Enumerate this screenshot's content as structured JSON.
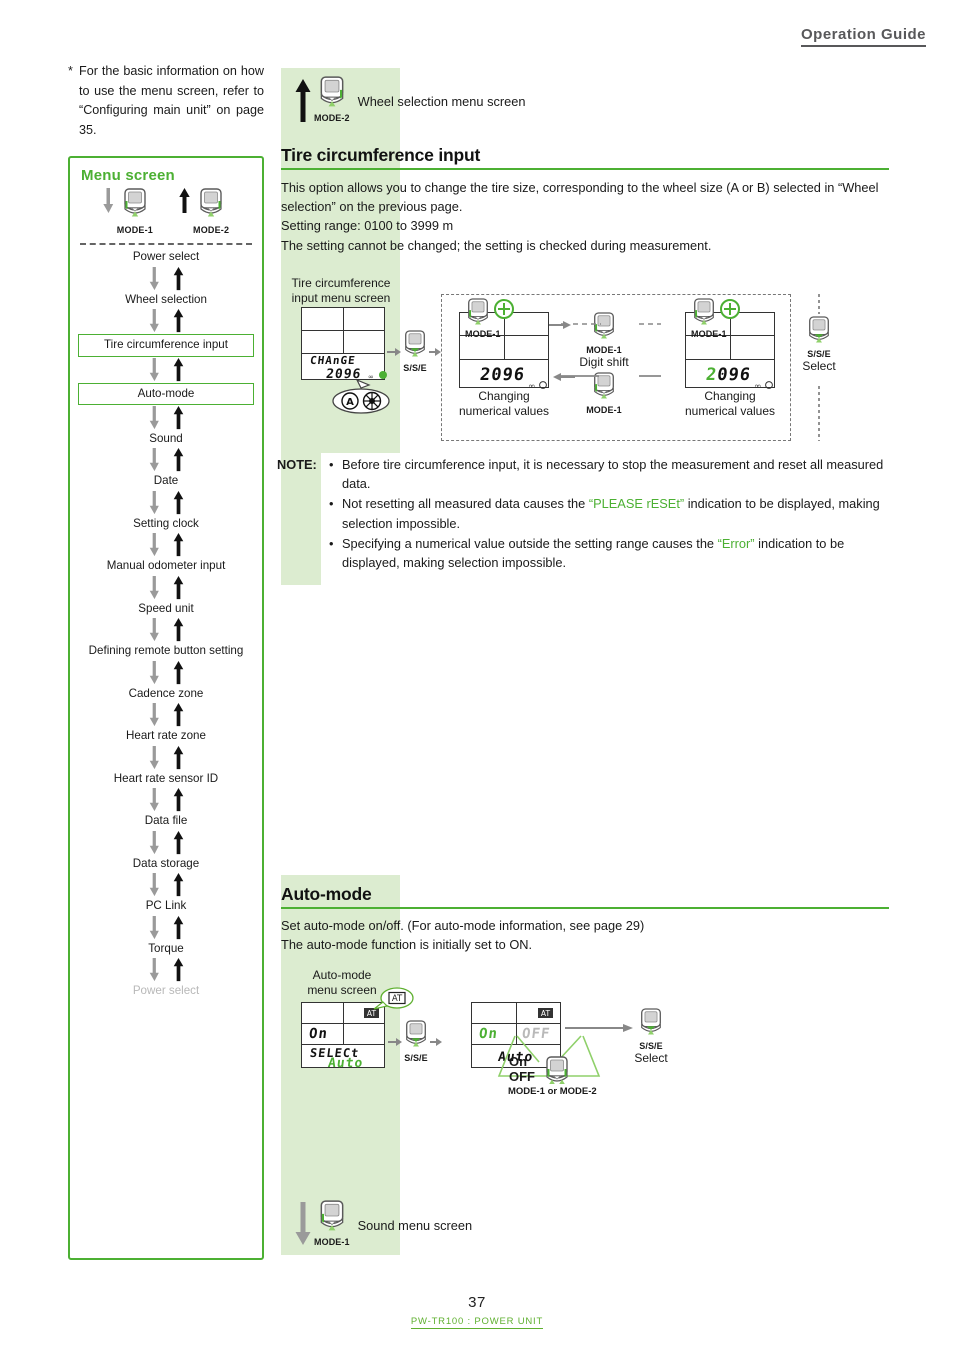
{
  "header": {
    "title": "Operation Guide"
  },
  "footer": {
    "page_number": "37",
    "product_line": "PW-TR100 : POWER UNIT"
  },
  "left": {
    "footnote": "For the basic information on how to use the menu screen, refer to “Configuring main unit” on page 35.",
    "footnote_marker": "*",
    "menu_box": {
      "title": "Menu screen",
      "mode_down_label": "MODE-1",
      "mode_up_label": "MODE-2",
      "items": [
        {
          "label": "Power select",
          "boxed": false,
          "dim": false
        },
        {
          "label": "Wheel selection",
          "boxed": false,
          "dim": false
        },
        {
          "label": "Tire circumference input",
          "boxed": true,
          "dim": false
        },
        {
          "label": "Auto-mode",
          "boxed": true,
          "dim": false
        },
        {
          "label": "Sound",
          "boxed": false,
          "dim": false
        },
        {
          "label": "Date",
          "boxed": false,
          "dim": false
        },
        {
          "label": "Setting clock",
          "boxed": false,
          "dim": false
        },
        {
          "label": "Manual odometer input",
          "boxed": false,
          "dim": false
        },
        {
          "label": "Speed unit",
          "boxed": false,
          "dim": false
        },
        {
          "label": "Defining remote button setting",
          "boxed": false,
          "dim": false
        },
        {
          "label": "Cadence zone",
          "boxed": false,
          "dim": false
        },
        {
          "label": "Heart rate zone",
          "boxed": false,
          "dim": false
        },
        {
          "label": "Heart rate sensor ID",
          "boxed": false,
          "dim": false
        },
        {
          "label": "Data file",
          "boxed": false,
          "dim": false
        },
        {
          "label": "Data storage",
          "boxed": false,
          "dim": false
        },
        {
          "label": "PC Link",
          "boxed": false,
          "dim": false
        },
        {
          "label": "Torque",
          "boxed": false,
          "dim": false
        },
        {
          "label": "Power select",
          "boxed": false,
          "dim": true
        }
      ]
    }
  },
  "top_nav": {
    "mode_label": "MODE-2",
    "caption": "Wheel selection menu screen"
  },
  "tire": {
    "heading": "Tire circumference input",
    "para1": "This option allows you to change the tire size, corresponding to the wheel size (A or B) selected in “Wheel selection” on the previous page.",
    "para2": "Setting range: 0100 to 3999 m",
    "para3": "The setting cannot be changed; the setting is checked during measurement.",
    "diagram": {
      "menu_caption_line1": "Tire circumference",
      "menu_caption_line2": "input menu screen",
      "lcd1_text_top": "CHAnGE",
      "lcd1_text_bottom": "2096",
      "lcd1_badge_a": "A",
      "lcd1_badge_wheel": "wheel-icon",
      "btn_sse": "S/S/E",
      "lcd2_mode_label": "MODE-1",
      "lcd2_value": "2096",
      "lcd2_cap1": "Changing",
      "lcd2_cap2": "numerical values",
      "mid_mode_label": "MODE-1",
      "mid_mode_sub": "Digit shift",
      "mid_mode_label2": "MODE-1",
      "lcd3_mode_label": "MODE-1",
      "lcd3_value": "2096",
      "lcd3_cap1": "Changing",
      "lcd3_cap2": "numerical values",
      "right_btn": "S/S/E",
      "right_btn_sub": "Select",
      "plus_icon": "plus-icon"
    },
    "note": {
      "label": "NOTE:",
      "items": [
        {
          "pre": "Before tire circumference input, it is necessary to stop the measurement and reset all measured data.",
          "green": "",
          "post": ""
        },
        {
          "pre": "Not resetting all measured data causes the ",
          "green": "“PLEASE rESEt”",
          "post": " indication to be displayed, making selection impossible."
        },
        {
          "pre": "Specifying a numerical value outside the setting range causes the ",
          "green": "“Error”",
          "post": " indication to be displayed, making selection impossible."
        }
      ]
    }
  },
  "auto": {
    "heading": "Auto-mode",
    "para1": "Set auto-mode on/off. (For auto-mode information, see page 29)",
    "para2": "The auto-mode function is initially set to ON.",
    "diagram": {
      "menu_caption_line1": "Auto-mode",
      "menu_caption_line2": "menu screen",
      "lcd1_at": "AT",
      "lcd1_on": "On",
      "lcd1_select": "SELECt",
      "lcd1_auto": "Auto",
      "callout_at": "AT",
      "btn_sse": "S/S/E",
      "lcd2_at": "AT",
      "lcd2_on": "On",
      "lcd2_off": "OFF",
      "lcd2_auto": "Auto",
      "choice_on": "On",
      "choice_off": "OFF",
      "choice_btn": "MODE-1 or MODE-2",
      "right_btn": "S/S/E",
      "right_btn_sub": "Select"
    },
    "bottom_nav": {
      "mode_label": "MODE-1",
      "caption": "Sound menu screen"
    }
  },
  "colors": {
    "brand_green": "#4cb033",
    "panel_green": "#dcecd0",
    "header_gray": "#58585a",
    "lcd_green": "#4cb033"
  }
}
